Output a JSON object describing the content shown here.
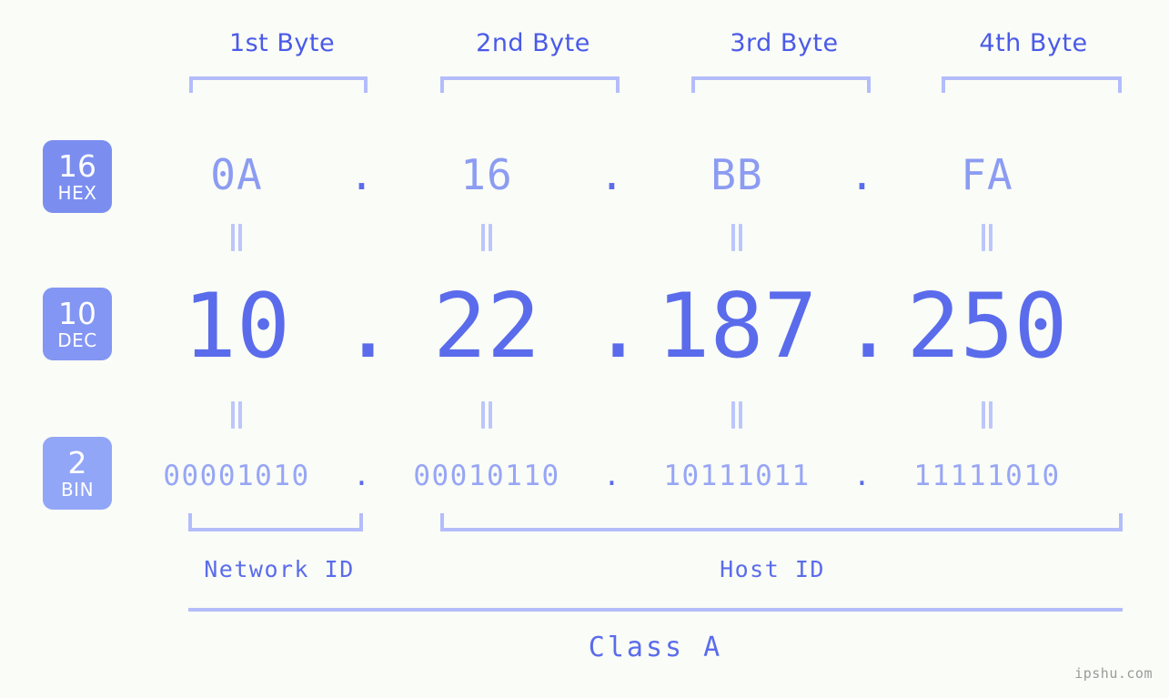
{
  "background_color": "#fafcf7",
  "accent_colors": {
    "strong_blue": "#5a6ceb",
    "header_blue": "#4a5ae8",
    "mid_blue": "#8c9cf2",
    "light_blue": "#b3bdfb",
    "badge_hex": "#7b8ef0",
    "badge_dec": "#8396f3",
    "badge_bin": "#92a6f7"
  },
  "header": {
    "byte_labels": [
      "1st Byte",
      "2nd Byte",
      "3rd Byte",
      "4th Byte"
    ]
  },
  "badges": [
    {
      "number": "16",
      "name": "HEX"
    },
    {
      "number": "10",
      "name": "DEC"
    },
    {
      "number": "2",
      "name": "BIN"
    }
  ],
  "separator": ".",
  "rows": {
    "hex": {
      "base_label": "HEX",
      "base_number": "16",
      "octets": [
        "0A",
        "16",
        "BB",
        "FA"
      ],
      "full_value": "0A.16.BB.FA"
    },
    "dec": {
      "base_label": "DEC",
      "base_number": "10",
      "octets": [
        "10",
        "22",
        "187",
        "250"
      ],
      "full_value": "10.22.187.250"
    },
    "bin": {
      "base_label": "BIN",
      "base_number": "2",
      "octets": [
        "00001010",
        "00010110",
        "10111011",
        "11111010"
      ],
      "full_value": "00001010.00010110.10111011.11111010"
    }
  },
  "equality_marker": "=",
  "footer": {
    "network_id_label": "Network ID",
    "host_id_label": "Host ID",
    "class_label": "Class A",
    "watermark": "ipshu.com"
  }
}
